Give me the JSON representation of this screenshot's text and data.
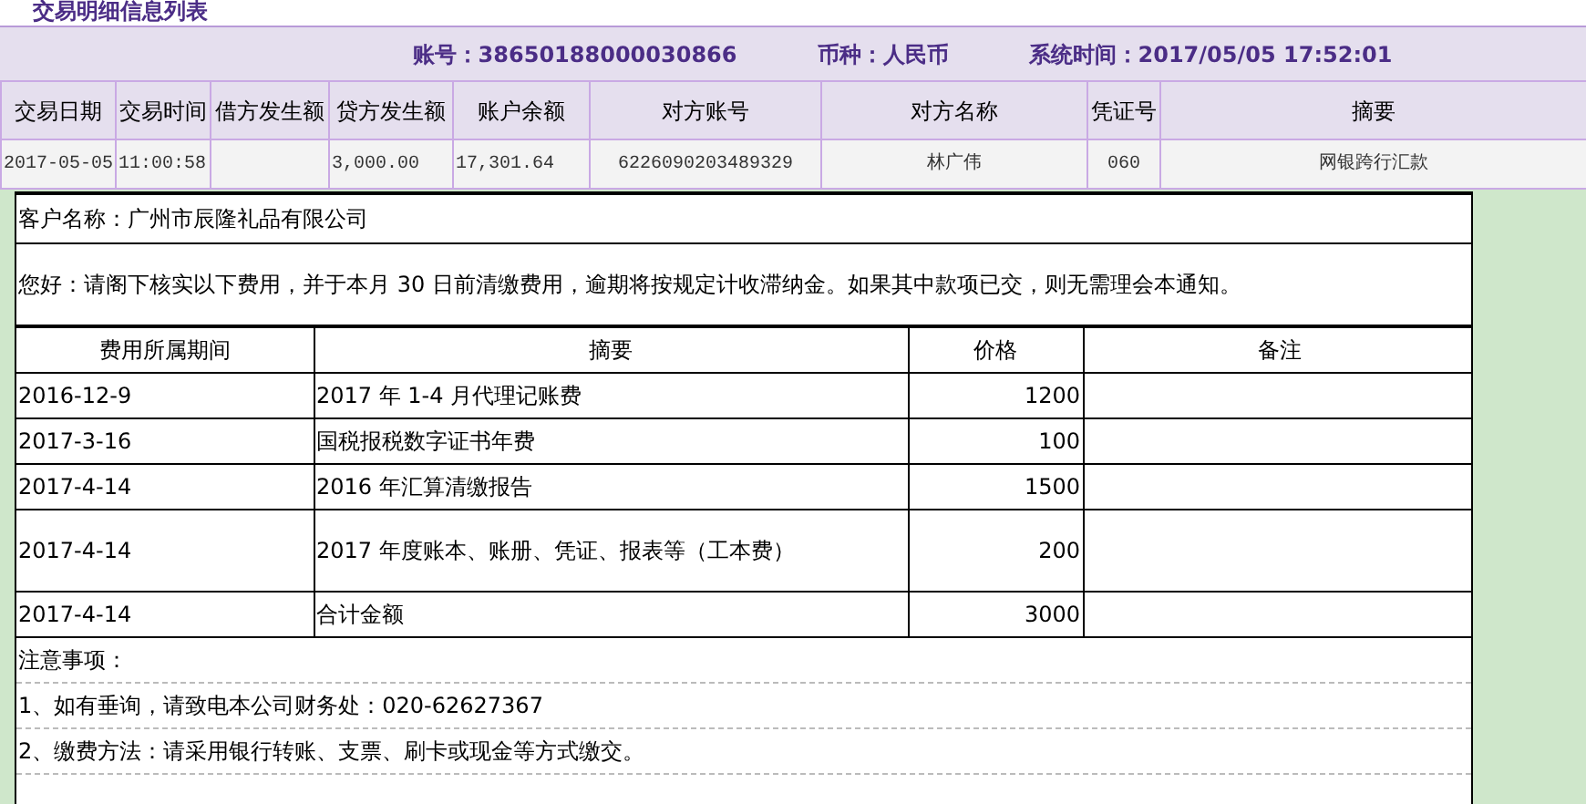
{
  "page_title": "交易明细信息列表",
  "account_bar": [
    {
      "label": "账号：",
      "value": "38650188000030866"
    },
    {
      "label": "币种：",
      "value": "人民币"
    },
    {
      "label": "系统时间：",
      "value": "2017/05/05  17:52:01"
    }
  ],
  "transactions": {
    "columns": [
      "交易日期",
      "交易时间",
      "借方发生额",
      "贷方发生额",
      "账户余额",
      "对方账号",
      "对方名称",
      "凭证号",
      "摘要"
    ],
    "rows": [
      [
        "2017-05-05",
        "11:00:58",
        "",
        "3,000.00",
        "17,301.64",
        "6226090203489329",
        "林广伟",
        "060",
        "网银跨行汇款"
      ]
    ]
  },
  "document": {
    "customer": "客户名称：广州市辰隆礼品有限公司",
    "greeting": "您好：请阁下核实以下费用，并于本月 30 日前清缴费用，逾期将按规定计收滞纳金。如果其中款项已交，则无需理会本通知。",
    "fee_columns": [
      "费用所属期间",
      "摘要",
      "价格",
      "备注"
    ],
    "fee_rows": [
      [
        "2016-12-9",
        "2017 年 1-4 月代理记账费",
        "1200",
        ""
      ],
      [
        "2017-3-16",
        "国税报税数字证书年费",
        "100",
        ""
      ],
      [
        "2017-4-14",
        "2016 年汇算清缴报告",
        "1500",
        ""
      ],
      [
        "2017-4-14",
        "2017 年度账本、账册、凭证、报表等（工本费）",
        "200",
        ""
      ],
      [
        "2017-4-14",
        "合计金额",
        "3000",
        ""
      ]
    ],
    "notes_title": "注意事项：",
    "notes": [
      "1、如有垂询，请致电本公司财务处：020-62627367",
      "2、缴费方法：请采用银行转账、支票、刷卡或现金等方式缴交。"
    ]
  }
}
